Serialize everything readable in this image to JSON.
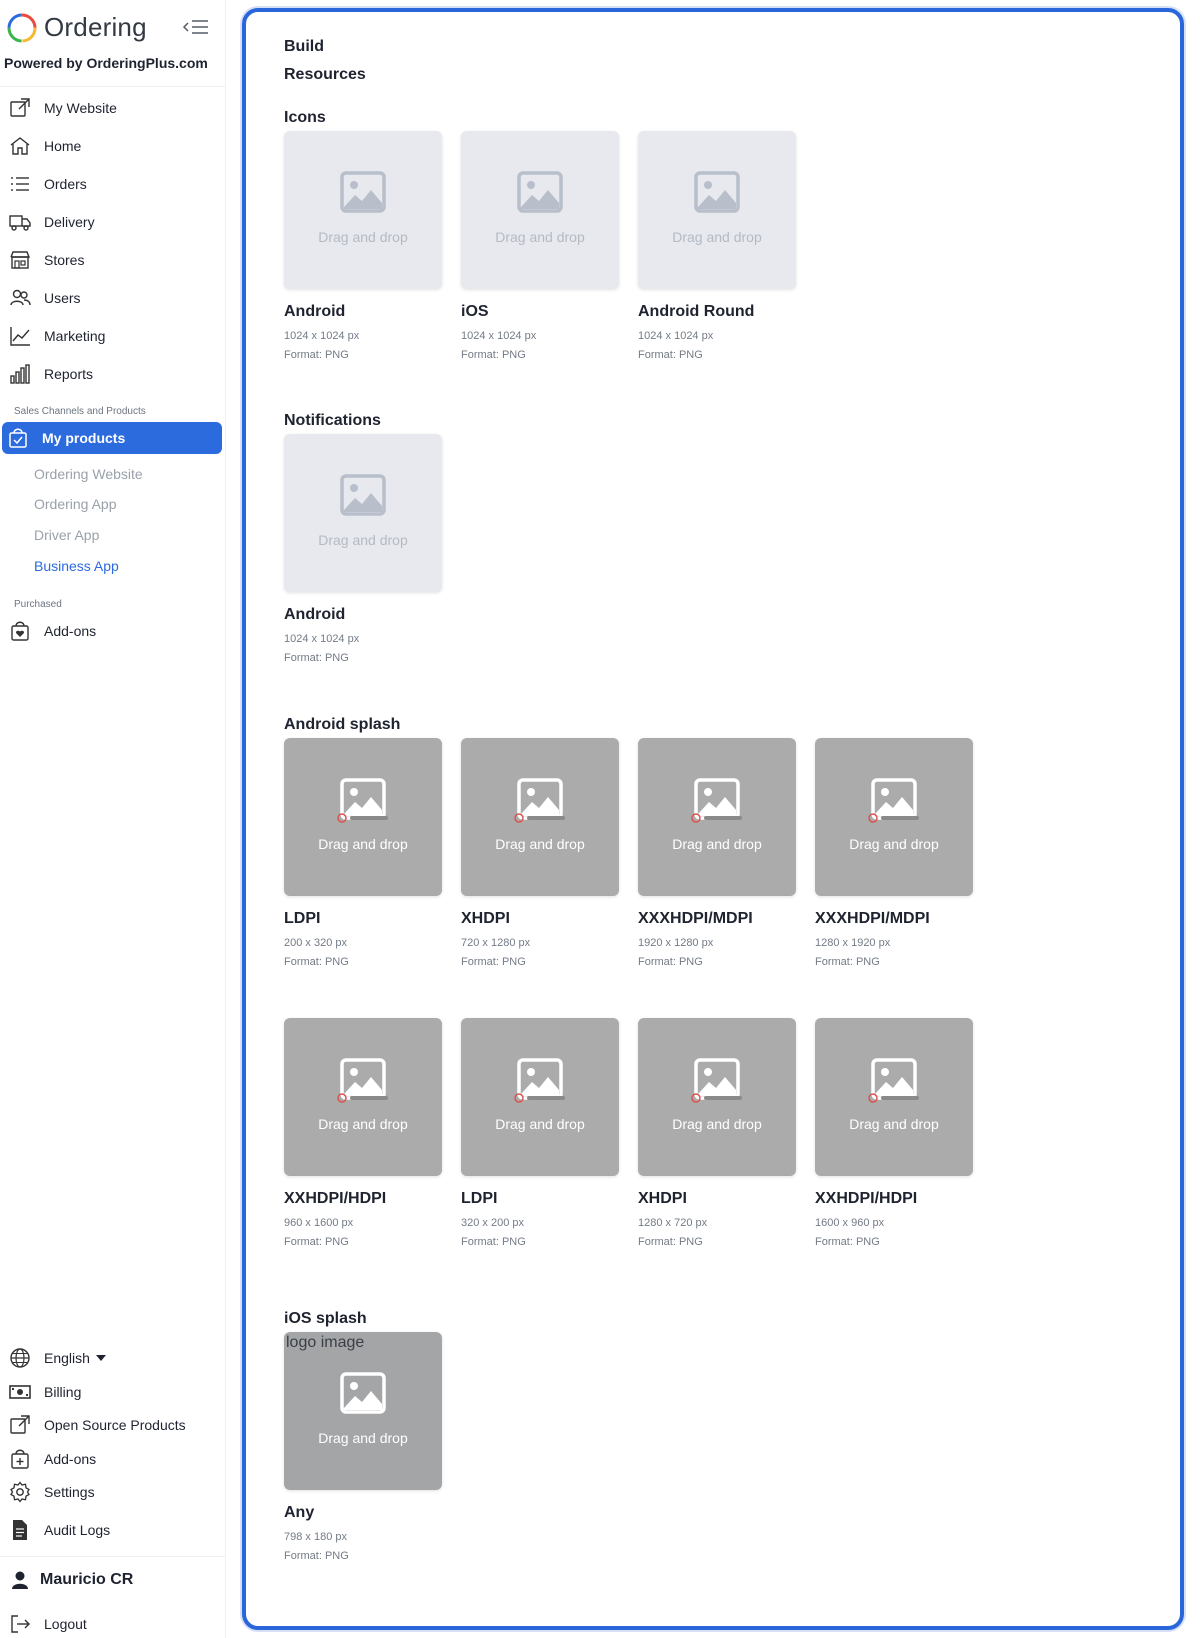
{
  "brand": {
    "name": "Ordering",
    "powered_by": "Powered by OrderingPlus.com"
  },
  "nav": {
    "items": [
      {
        "label": "My Website",
        "icon": "external-link-icon"
      },
      {
        "label": "Home",
        "icon": "home-icon"
      },
      {
        "label": "Orders",
        "icon": "list-icon"
      },
      {
        "label": "Delivery",
        "icon": "truck-icon"
      },
      {
        "label": "Stores",
        "icon": "shop-icon"
      },
      {
        "label": "Users",
        "icon": "users-icon"
      },
      {
        "label": "Marketing",
        "icon": "chart-line-icon"
      },
      {
        "label": "Reports",
        "icon": "bar-chart-icon"
      }
    ],
    "section_sales": "Sales Channels and Products",
    "my_products": "My products",
    "sub_items": [
      "Ordering Website",
      "Ordering App",
      "Driver App",
      "Business App"
    ],
    "section_purchased": "Purchased",
    "addons": "Add-ons",
    "bottom": {
      "language": "English",
      "billing": "Billing",
      "open_source": "Open Source Products",
      "addons": "Add-ons",
      "settings": "Settings",
      "audit_logs": "Audit Logs"
    },
    "user_name": "Mauricio CR",
    "logout": "Logout"
  },
  "main": {
    "crumb_build": "Build",
    "crumb_resources": "Resources",
    "drop_label": "Drag and drop",
    "alt_text": "logo image",
    "sections": {
      "icons": "Icons",
      "notifications": "Notifications",
      "android_splash": "Android splash",
      "ios_splash": "iOS splash"
    },
    "icons": [
      {
        "name": "Android",
        "size": "1024 x 1024 px",
        "format": "Format: PNG"
      },
      {
        "name": "iOS",
        "size": "1024 x 1024 px",
        "format": "Format: PNG"
      },
      {
        "name": "Android Round",
        "size": "1024 x 1024 px",
        "format": "Format: PNG"
      }
    ],
    "notifications": [
      {
        "name": "Android",
        "size": "1024 x 1024 px",
        "format": "Format: PNG"
      }
    ],
    "android_splash": [
      {
        "name": "LDPI",
        "size": "200 x 320 px",
        "format": "Format: PNG"
      },
      {
        "name": "XHDPI",
        "size": "720 x 1280 px",
        "format": "Format: PNG"
      },
      {
        "name": "XXXHDPI/MDPI",
        "size": "1920 x 1280 px",
        "format": "Format: PNG"
      },
      {
        "name": "XXXHDPI/MDPI",
        "size": "1280 x 1920 px",
        "format": "Format: PNG"
      },
      {
        "name": "XXHDPI/HDPI",
        "size": "960 x 1600 px",
        "format": "Format: PNG"
      },
      {
        "name": "LDPI",
        "size": "320 x 200 px",
        "format": "Format: PNG"
      },
      {
        "name": "XHDPI",
        "size": "1280 x 720 px",
        "format": "Format: PNG"
      },
      {
        "name": "XXHDPI/HDPI",
        "size": "1600 x 960 px",
        "format": "Format: PNG"
      }
    ],
    "ios_splash": [
      {
        "name": "Any",
        "size": "798 x 180 px",
        "format": "Format: PNG"
      }
    ]
  },
  "colors": {
    "accent": "#2c6bde",
    "frame": "#2a66d9"
  }
}
